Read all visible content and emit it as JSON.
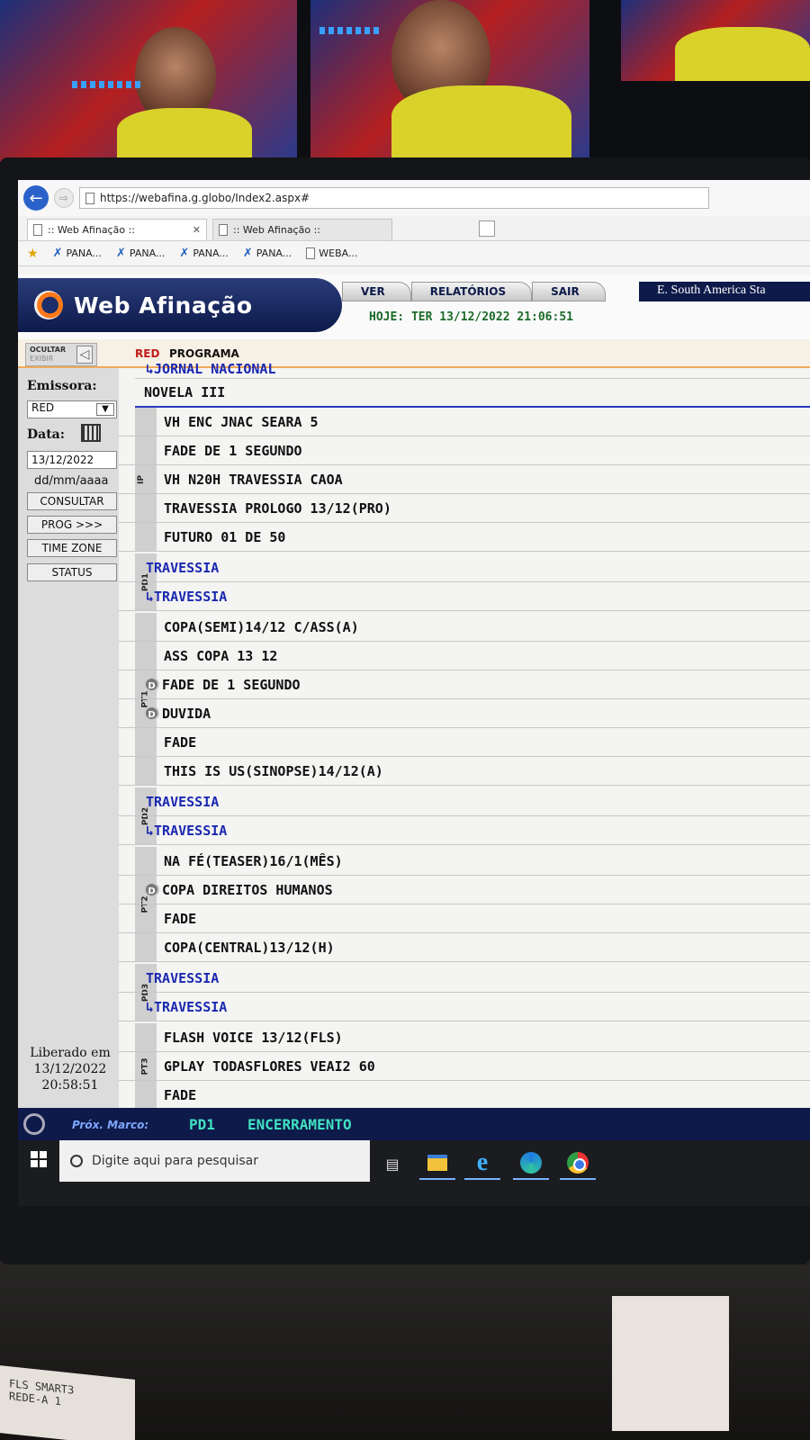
{
  "browser": {
    "url": "https://webafina.g.globo/Index2.aspx#",
    "tabs": [
      ":: Web Afinação ::",
      ":: Web Afinação ::"
    ],
    "favorites": [
      "PANA...",
      "PANA...",
      "PANA...",
      "PANA...",
      "WEBA..."
    ]
  },
  "app": {
    "logo_text": "Web Afinação",
    "menu": [
      "VER",
      "RELATÓRIOS",
      "SAIR"
    ],
    "timezone": "E. South America Sta",
    "today_label": "HOJE:",
    "today_value": "TER 13/12/2022 21:06:51"
  },
  "subheader": {
    "hide_label": "OCULTAR",
    "show_label": "EXIBIR",
    "col_station": "RED",
    "col_program": "PROGRAMA"
  },
  "sidebar": {
    "emissora_label": "Emissora:",
    "emissora_value": "RED",
    "data_label": "Data:",
    "data_value": "13/12/2022",
    "data_hint": "dd/mm/aaaa",
    "buttons": [
      "CONSULTAR",
      "PROG >>>",
      "TIME ZONE",
      "STATUS"
    ],
    "released_label": "Liberado em",
    "released_date": "13/12/2022",
    "released_time": "20:58:51"
  },
  "program": {
    "top_partial": "↳JORNAL NACIONAL",
    "novela": "NOVELA III",
    "sections": [
      {
        "code": "IP",
        "rows": [
          {
            "text": "VH ENC JNAC SEARA 5"
          },
          {
            "text": "FADE DE 1 SEGUNDO"
          },
          {
            "text": "VH N20H TRAVESSIA CAOA"
          },
          {
            "text": "TRAVESSIA PROLOGO 13/12(PRO)"
          },
          {
            "text": "FUTURO 01 DE 50"
          }
        ]
      },
      {
        "code": "PD1",
        "rows": [
          {
            "text": "TRAVESSIA",
            "blue": true
          },
          {
            "text": "↳TRAVESSIA",
            "blue": true
          }
        ]
      },
      {
        "code": "PT1",
        "rows": [
          {
            "text": "COPA(SEMI)14/12 C/ASS(A)"
          },
          {
            "text": "ASS COPA 13 12"
          },
          {
            "text": "FADE DE 1 SEGUNDO",
            "badge": "D"
          },
          {
            "text": "DUVIDA",
            "badge": "D"
          },
          {
            "text": "FADE"
          },
          {
            "text": "THIS IS US(SINOPSE)14/12(A)"
          }
        ]
      },
      {
        "code": "PD2",
        "rows": [
          {
            "text": "TRAVESSIA",
            "blue": true
          },
          {
            "text": "↳TRAVESSIA",
            "blue": true
          }
        ]
      },
      {
        "code": "PT2",
        "rows": [
          {
            "text": "NA FÉ(TEASER)16/1(MÊS)"
          },
          {
            "text": "COPA DIREITOS HUMANOS",
            "badge": "D"
          },
          {
            "text": "FADE"
          },
          {
            "text": "COPA(CENTRAL)13/12(H)"
          }
        ]
      },
      {
        "code": "PD3",
        "rows": [
          {
            "text": "TRAVESSIA",
            "blue": true
          },
          {
            "text": "↳TRAVESSIA",
            "blue": true
          }
        ]
      },
      {
        "code": "PT3",
        "rows": [
          {
            "text": "FLASH VOICE 13/12(FLS)"
          },
          {
            "text": "GPLAY TODASFLORES VEAI2 60"
          },
          {
            "text": "FADE"
          }
        ]
      }
    ]
  },
  "status": {
    "next_label": "Próx. Marco:",
    "next_code": "PD1",
    "next_name": "ENCERRAMENTO"
  },
  "taskbar": {
    "search_placeholder": "Digite aqui para pesquisar"
  },
  "desk_label": [
    "FLS SMART3",
    "REDE-A 1"
  ],
  "colors": {
    "navy": "#0d1a4a",
    "accent_orange": "#ff7a1a",
    "program_blue": "#1a28b0",
    "today_green": "#1d6b2a",
    "station_red": "#c01a1a",
    "status_cyan": "#41e0c0"
  }
}
